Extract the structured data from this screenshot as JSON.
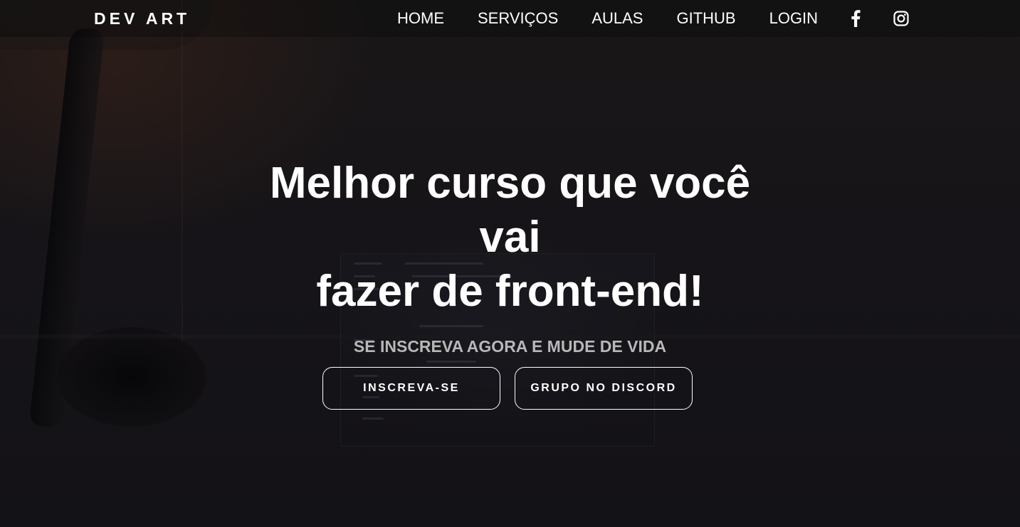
{
  "navbar": {
    "brand": "DEV ART",
    "links": [
      {
        "label": "HOME"
      },
      {
        "label": "SERVIÇOS"
      },
      {
        "label": "AULAS"
      },
      {
        "label": "GITHUB"
      },
      {
        "label": "LOGIN"
      }
    ],
    "social_icons": [
      {
        "icon": "facebook-icon"
      },
      {
        "icon": "instagram-icon"
      }
    ]
  },
  "hero": {
    "title_line1": "Melhor curso que você vai",
    "title_line2": "fazer de front-end!",
    "subtitle": "SE INSCREVA AGORA E MUDE DE VIDA",
    "buttons": {
      "primary_label": "INSCREVA-SE",
      "secondary_label": "GRUPO NO DISCORD"
    }
  },
  "colors": {
    "background": "#141317",
    "text": "#ffffff",
    "subtitle": "#b8b8b8",
    "button_border": "#ffffff"
  }
}
